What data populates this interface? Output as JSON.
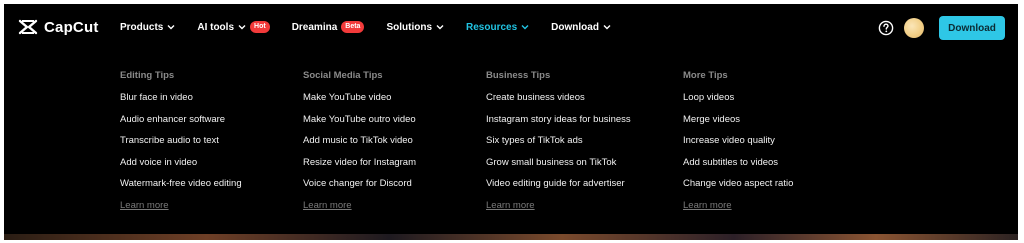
{
  "brand": {
    "name": "CapCut"
  },
  "nav": {
    "products": "Products",
    "ai_tools": "AI tools",
    "ai_tools_badge": "Hot",
    "dreamina": "Dreamina",
    "dreamina_badge": "Beta",
    "solutions": "Solutions",
    "resources": "Resources",
    "download_menu": "Download"
  },
  "actions": {
    "download_button": "Download"
  },
  "icons": {
    "logo": "capcut-logo-icon",
    "chevron": "chevron-down-icon",
    "help": "question-circle-icon",
    "avatar": "user-avatar"
  },
  "colors": {
    "background": "#000000",
    "accent": "#2ec7e6",
    "active_nav": "#21c4e3",
    "badge": "#f23a3a"
  },
  "menu": {
    "columns": [
      {
        "title": "Editing Tips",
        "links": [
          "Blur face in video",
          "Audio enhancer software",
          "Transcribe audio to text",
          "Add voice in video",
          "Watermark-free video editing"
        ],
        "more": "Learn more"
      },
      {
        "title": "Social Media Tips",
        "links": [
          "Make YouTube video",
          "Make YouTube outro video",
          "Add music to TikTok video",
          "Resize video for Instagram",
          "Voice changer for Discord"
        ],
        "more": "Learn more"
      },
      {
        "title": "Business Tips",
        "links": [
          "Create business videos",
          "Instagram story ideas for business",
          "Six types of TikTok ads",
          "Grow small business on TikTok",
          "Video editing guide for advertiser"
        ],
        "more": "Learn more"
      },
      {
        "title": "More Tips",
        "links": [
          "Loop videos",
          "Merge videos",
          "Increase video quality",
          "Add subtitles to videos",
          "Change video aspect ratio"
        ],
        "more": "Learn more"
      }
    ]
  }
}
